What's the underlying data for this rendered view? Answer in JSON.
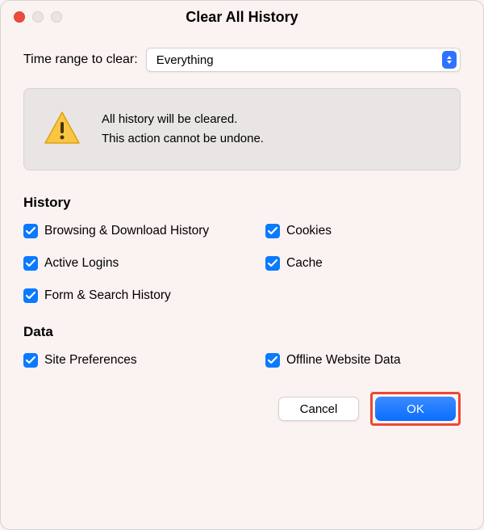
{
  "title": "Clear All History",
  "range": {
    "label": "Time range to clear:",
    "value": "Everything"
  },
  "warning": {
    "line1": "All history will be cleared.",
    "line2": "This action cannot be undone."
  },
  "sections": {
    "history": {
      "title": "History",
      "items": {
        "browsing": "Browsing & Download History",
        "cookies": "Cookies",
        "activeLogins": "Active Logins",
        "cache": "Cache",
        "formSearch": "Form & Search History"
      }
    },
    "data": {
      "title": "Data",
      "items": {
        "sitePrefs": "Site Preferences",
        "offline": "Offline Website Data"
      }
    }
  },
  "buttons": {
    "cancel": "Cancel",
    "ok": "OK"
  }
}
